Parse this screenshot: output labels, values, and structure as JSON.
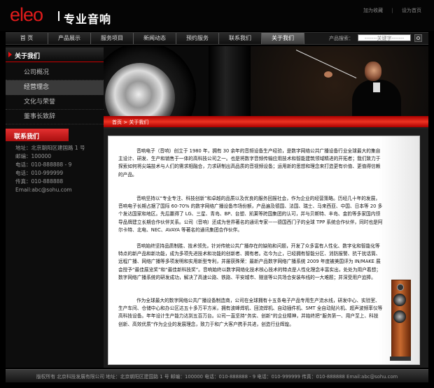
{
  "header": {
    "logo_text": "eleo",
    "logo_cn": "专业音响",
    "links": [
      "加为收藏",
      "设为首页"
    ]
  },
  "nav": {
    "items": [
      "首 页",
      "产品展示",
      "服务项目",
      "新闻动态",
      "预约服务",
      "联系我们",
      "关于我们"
    ],
    "active_index": 6,
    "search_label": "产品搜索：",
    "search_placeholder": "-------关键字-------"
  },
  "sidebar": {
    "title": "关于我们",
    "items": [
      "公司概况",
      "经营理念",
      "文化与荣誉",
      "董事长致辞"
    ],
    "selected_index": 1,
    "contact_title": "联系我们",
    "contact_lines": [
      "地址：北京朝阳区建国路 1 号",
      "邮编：100000",
      "电话：010-888888 - 9",
      "电话：010-999999",
      "传真：010-888888",
      "Email:abc@sohu.com"
    ]
  },
  "breadcrumb": "首页 > 关于我们",
  "content": {
    "paragraphs": [
      "音响电子（音响）创立于 1980 年，拥有 30 余年的音频设备生产经验，是数字网络公共广播设备行业全球最大的集自主设计、研发、生产和销售于一体的高科技公司之一。也是将数字音频传输应用技术和智能建筑领域精进的开拓者；我们致力于探索如何将尖端技术与人们的需求相融合，力求研制出高品质的音视频设备；运用新的思想和理念来打造更有价值、更值得信赖的产品。",
      "音响坚持以“专业专注、科技创新”和卓越的品质以及优良的服务回报社会，作为企业的经营策略。历经几十年的发展，音响电子长期占据了国际 60-70% 的数字网络广播设备市场份额，产品遍及德国、法国、瑞士、马来西亚、中国、日本等 20 多个发达国家和地区。先后赢得了 LG、三星、青岛、BP、台塑、凯莱等跨国集团的认可，并与贝斯特、丰岛、金豹等多家国内领导品牌建立长期合作伙伴关系。公司（音响）还成为世界著名的通讯专家——德国西门子的全球 TPP 系统合作伙伴，同时也是阿尔卡特、北电、NEC、AVAYA 等著名的通讯集团合作伙伴。",
      "音响始终坚持品质制胜、技术领先，针对传统公共广播存在的缺陷和问题，开发了众多富有人性化、数字化和智能化等特点的新产品和新功能，成为多项先进技术和功能的创新者、拥有者。迄今为止，已经拥有智能分区、消防报警、抗干扰话筒、远程广播、网络广播等多项发明和实用新型专利，并屡获殊荣：最新产品数字网络广播系统 2009 年度被美国评为 IN/MAKE 展会授予“最佳展览奖”和“最佳新科技奖”。音响始终以数字网络化技术核心技术的特点是人性化理念丰富实出，处处为用户着想；数字网络广播系统的研发成功，解决了高速公路、铁路、平安城市、隧道等公共场合安装布线的一大难题；并深受用户追捧。",
      "作为全球最大的数字网络公共广播设备制造商，公司在全球拥有十五条电子产品专用生产流水线，研发中心、实验室、生产车间、仓储中心和办公区达五十多万平方米，拥有波峰焊机、回流焊机、自动插件机、SMT 全自动贴片机、超声波频率仪等高科技设备。年年设计生产能力达到五百万台。公司一直坚持“务实、创新”的企业精神，并始终把“服务第一、用户至上、科技创新、高效优质”作为企业的发展理念，致力于和广大客户携手共进，创造行业辉煌。"
    ]
  },
  "footer": {
    "text": "版权所有  北京科技发展有限公司  地址：北京朝阳区建国路 1 号  邮编：100000  电话：010-888888 - 9  电话：010-999999  传真：010-888888  Email:abc@sohu.com"
  },
  "colors": {
    "accent": "#e11b1b",
    "background": "#000000"
  }
}
